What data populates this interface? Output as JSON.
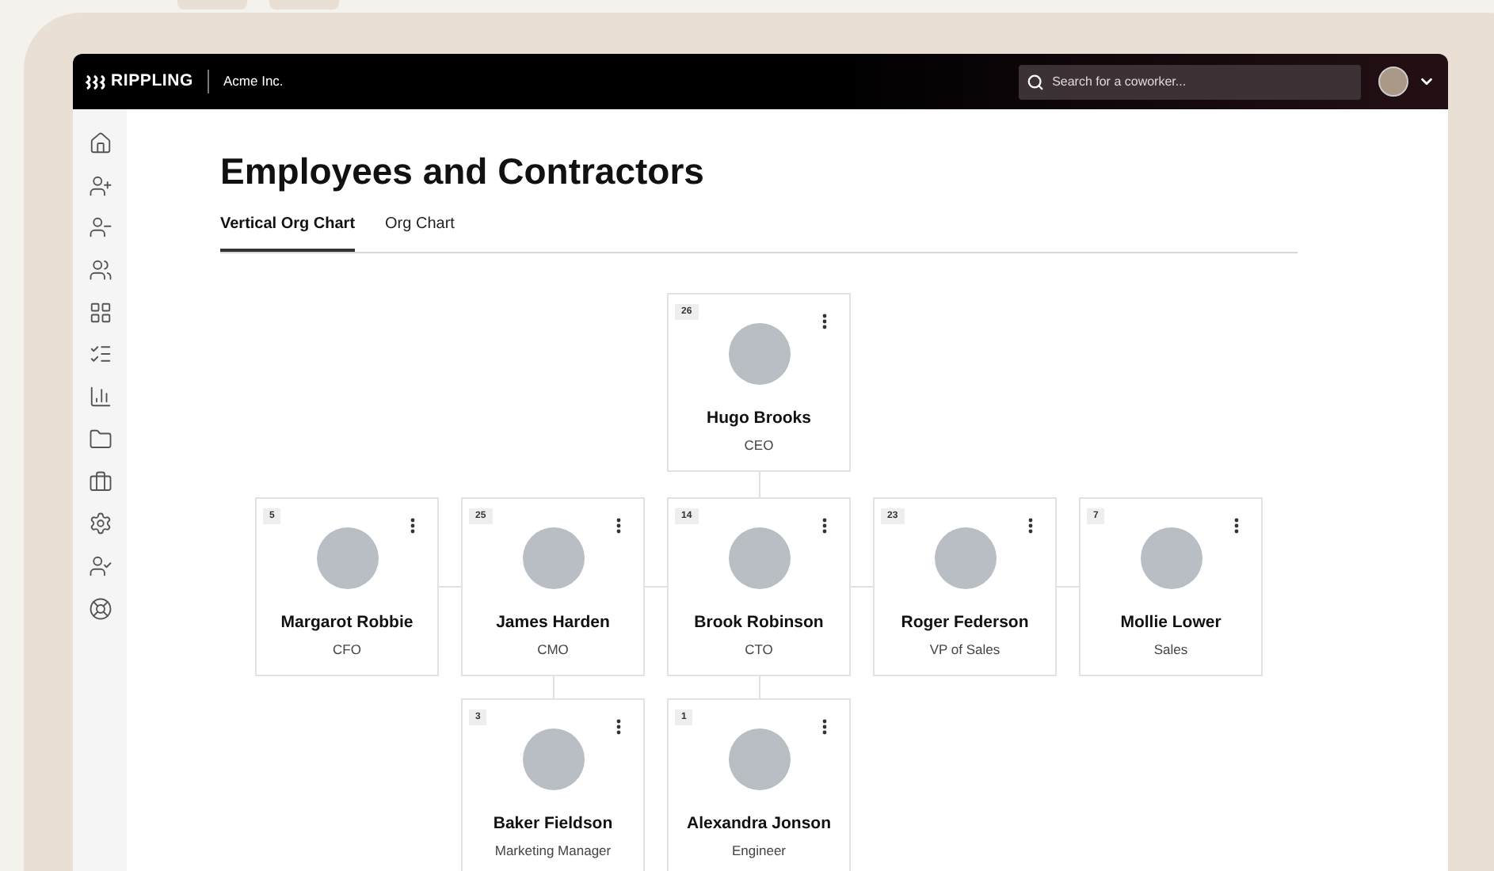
{
  "header": {
    "brand": "RIPPLING",
    "company": "Acme Inc.",
    "search": {
      "placeholder": "Search for a coworker..."
    }
  },
  "page": {
    "title": "Employees and Contractors"
  },
  "tabs": [
    {
      "label": "Vertical Org Chart",
      "selected": true
    },
    {
      "label": "Org Chart",
      "selected": false
    }
  ],
  "org_chart": {
    "count": "26",
    "name": "Hugo Brooks",
    "title": "CEO",
    "children": [
      {
        "count": "5",
        "name": "Margarot Robbie",
        "title": "CFO"
      },
      {
        "count": "25",
        "name": "James Harden",
        "title": "CMO",
        "children": [
          {
            "count": "3",
            "name": "Baker Fieldson",
            "title": "Marketing Manager"
          }
        ]
      },
      {
        "count": "14",
        "name": "Brook Robinson",
        "title": "CTO",
        "children": [
          {
            "count": "1",
            "name": "Alexandra Jonson",
            "title": "Engineer"
          }
        ]
      },
      {
        "count": "23",
        "name": "Roger Federson",
        "title": "VP of Sales"
      },
      {
        "count": "7",
        "name": "Mollie Lower",
        "title": "Sales"
      }
    ]
  }
}
